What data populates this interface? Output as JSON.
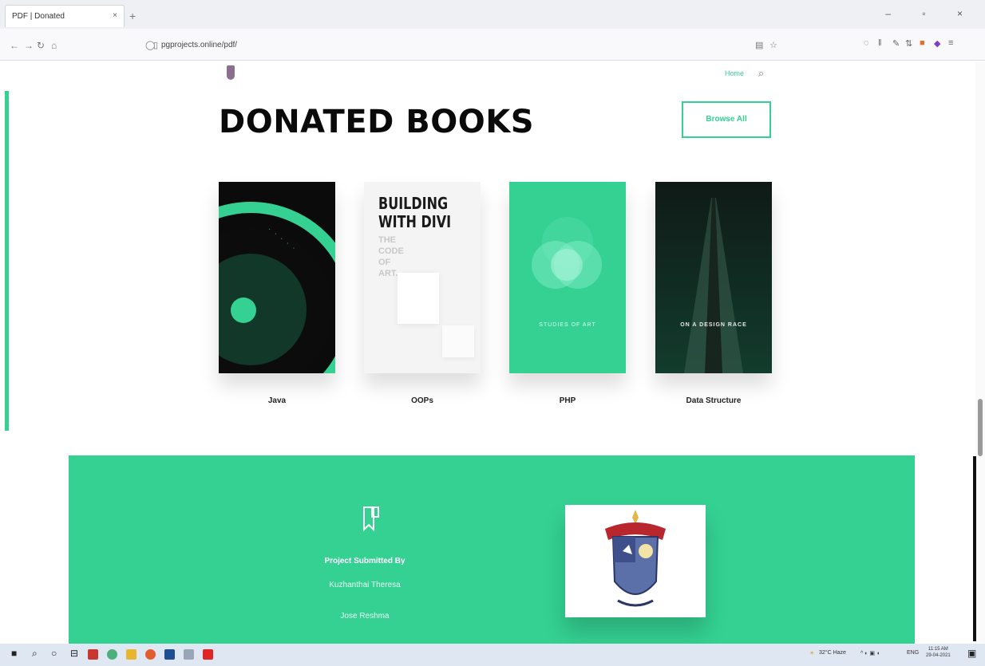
{
  "browser": {
    "tab_title": "PDF | Donated",
    "tab_close": "×",
    "new_tab": "+",
    "window_controls": "– ▫ ×",
    "url": "pgprojects.online/pdf/"
  },
  "site": {
    "nav_home": "Home"
  },
  "page": {
    "title": "DONATED BOOKS",
    "browse_label": "Browse All"
  },
  "books": [
    {
      "name": "Java",
      "cover_color": "#0b0b0b"
    },
    {
      "name": "OOPs",
      "cover_title": "BUILDING WITH DIVI",
      "cover_subtitle": "THE CODE OF ART."
    },
    {
      "name": "PHP",
      "cover_text": "STUDIES OF ART"
    },
    {
      "name": "Data Structure",
      "cover_text": "ON A DESIGN RACE"
    }
  ],
  "footer": {
    "heading": "Project Submitted By",
    "name1": "Kuzhanthai Theresa",
    "name2": "Jose Reshma",
    "background": "#34d192"
  },
  "taskbar": {
    "weather": "32°C Haze",
    "lang": "ENG",
    "time": "11:15 AM",
    "date": "29-04-2021"
  },
  "colors": {
    "accent": "#34d192",
    "title": "#0a0a0a"
  }
}
